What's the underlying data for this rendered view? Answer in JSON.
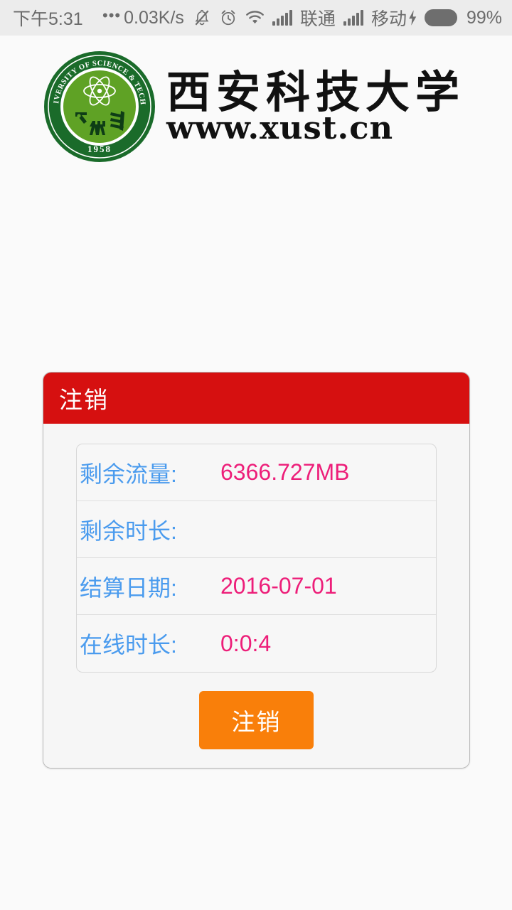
{
  "status_bar": {
    "clock": "下午5:31",
    "network_speed": "0.03K/s",
    "speed_dots": "•••",
    "icons": [
      {
        "name": "bell-muted-icon",
        "glyph": "bell-muted"
      },
      {
        "name": "alarm-clock-icon",
        "glyph": "alarm"
      },
      {
        "name": "wifi-icon",
        "glyph": "wifi"
      }
    ],
    "carrier_1": {
      "label": "联通",
      "signal_bars": 5
    },
    "carrier_2": {
      "label": "移动",
      "signal_bars": 5
    },
    "charging_glyph": "⚡",
    "battery_percent": "99%"
  },
  "brand": {
    "name_cn": "西安科技大学",
    "website": "www.xust.cn",
    "seal": {
      "outer_text_en": "XI'AN UNIVERSITY OF SCIENCE & TECHNOLOGY",
      "founded_year": "1958",
      "ring_color": "#1a6b2a",
      "disc_color": "#5fa225"
    }
  },
  "panel": {
    "header_title": "注销",
    "header_color": "#d61010",
    "rows": [
      {
        "label": "剩余流量:",
        "value": "6366.727MB"
      },
      {
        "label": "剩余时长:",
        "value": ""
      },
      {
        "label": "结算日期:",
        "value": "2016-07-01"
      },
      {
        "label": "在线时长:",
        "value": "0:0:4"
      }
    ],
    "label_color": "#4a9bee",
    "value_color": "#ed1e79",
    "logout_button": {
      "label": "注销",
      "color": "#f97f0a"
    }
  }
}
